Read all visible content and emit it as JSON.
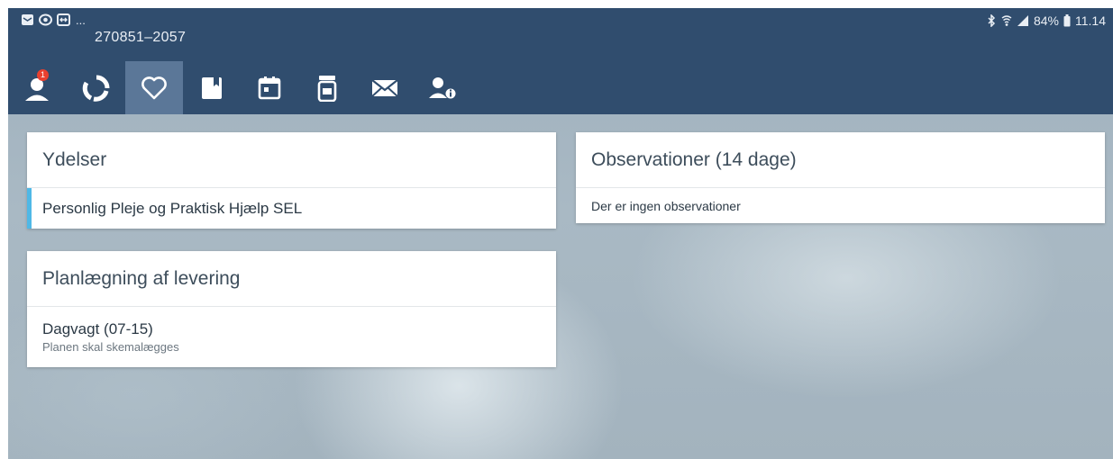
{
  "status_bar": {
    "left_icons": [
      "mail-icon",
      "eye-icon",
      "screen-share-icon"
    ],
    "left_overflow": "...",
    "patient_id": "270851–2057",
    "right_icons": [
      "bluetooth-icon",
      "wifi-icon",
      "signal-icon",
      "battery-icon"
    ],
    "battery": "84%",
    "clock": "11.14"
  },
  "toolbar": {
    "active_index": 2,
    "tabs": [
      {
        "icon": "person-alert-icon",
        "badge": "1"
      },
      {
        "icon": "cycle-icon"
      },
      {
        "icon": "heart-icon"
      },
      {
        "icon": "bookmark-icon"
      },
      {
        "icon": "calendar-icon"
      },
      {
        "icon": "medicine-icon"
      },
      {
        "icon": "mail-icon"
      },
      {
        "icon": "person-info-icon"
      }
    ]
  },
  "cards": {
    "ydelser": {
      "title": "Ydelser",
      "items": [
        {
          "label": "Personlig Pleje og Praktisk Hjælp SEL"
        }
      ]
    },
    "planlaegning": {
      "title": "Planlægning af levering",
      "items": [
        {
          "title": "Dagvagt (07-15)",
          "subtitle": "Planen skal skemalægges"
        }
      ]
    },
    "observationer": {
      "title": "Observationer (14 dage)",
      "empty_text": "Der er ingen observationer"
    }
  },
  "colors": {
    "appbar": "#304d6e",
    "active_tab": "#5b7798",
    "accent": "#4fb8e6",
    "badge": "#e9402f"
  }
}
